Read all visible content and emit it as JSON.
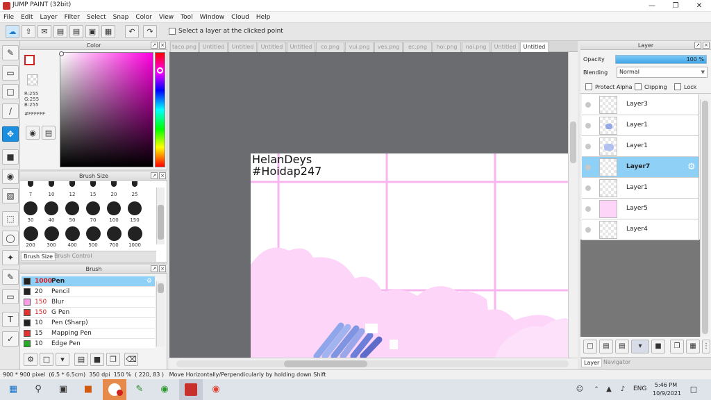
{
  "window": {
    "title": "JUMP PAINT (32bit)"
  },
  "menu": [
    "File",
    "Edit",
    "Layer",
    "Filter",
    "Select",
    "Snap",
    "Color",
    "View",
    "Tool",
    "Window",
    "Cloud",
    "Help"
  ],
  "toolbar": {
    "select_layer_label": "Select a layer at the clicked point"
  },
  "color_panel": {
    "title": "Color",
    "r": "R:255",
    "g": "G:255",
    "b": "B:255",
    "hex": "#FFFFFF",
    "colors": {
      "primary": "#ffffff",
      "hue_selected": "#ff00e0"
    }
  },
  "brush_size_panel": {
    "title": "Brush Size",
    "sizes_row1": [
      "7",
      "10",
      "12",
      "15",
      "20",
      "25"
    ],
    "sizes_row2": [
      "30",
      "40",
      "50",
      "70",
      "100",
      "150"
    ],
    "sizes_row3": [
      "200",
      "300",
      "400",
      "500",
      "700",
      "1000"
    ],
    "tab_brush_size": "Brush Size",
    "tab_brush_control": "Brush Control"
  },
  "brush_panel": {
    "title": "Brush",
    "items": [
      {
        "size": "1000",
        "name": "Pen",
        "color": "#222222"
      },
      {
        "size": "20",
        "name": "Pencil",
        "color": "#222222"
      },
      {
        "size": "150",
        "name": "Blur",
        "color": "#ff9be6"
      },
      {
        "size": "150",
        "name": "G Pen",
        "color": "#e53030"
      },
      {
        "size": "10",
        "name": "Pen (Sharp)",
        "color": "#222222"
      },
      {
        "size": "15",
        "name": "Mapping Pen",
        "color": "#e53030"
      },
      {
        "size": "10",
        "name": "Edge Pen",
        "color": "#22aa22"
      }
    ]
  },
  "canvas": {
    "tabs": [
      "taco.png",
      "Untitled",
      "Untitled",
      "Untitled",
      "Untitled",
      "co.png",
      "vui.png",
      "ves.png",
      "ec.png",
      "hoi.png",
      "nai.png",
      "Untitled",
      "Untitled"
    ],
    "active_tab": 12,
    "text_line1": "HelanDeys",
    "text_line2": "#Hoidap247"
  },
  "layer_panel": {
    "title": "Layer",
    "opacity_label": "Opacity",
    "opacity_value": "100 %",
    "opacity_fraction": 1.0,
    "blending_label": "Blending",
    "blending_value": "Normal",
    "protect_alpha": "Protect Alpha",
    "clipping": "Clipping",
    "lock": "Lock",
    "layers": [
      {
        "name": "Layer3",
        "selected": false
      },
      {
        "name": "Layer1",
        "selected": false
      },
      {
        "name": "Layer1",
        "selected": false
      },
      {
        "name": "Layer7",
        "selected": true
      },
      {
        "name": "Layer1",
        "selected": false
      },
      {
        "name": "Layer5",
        "selected": false
      },
      {
        "name": "Layer4",
        "selected": false
      }
    ],
    "tab_layer": "Layer",
    "tab_navigator": "Navigator"
  },
  "status": {
    "size": "900 * 900 pixel",
    "physical": "(6.5 * 6.5cm)",
    "dpi": "350 dpi",
    "zoom": "150 %",
    "coords": "( 220, 83 )",
    "hint": "Move Horizontally/Perpendicularly by holding down Shift"
  },
  "taskbar": {
    "lang": "ENG",
    "time": "5:46 PM",
    "date": "10/9/2021"
  }
}
